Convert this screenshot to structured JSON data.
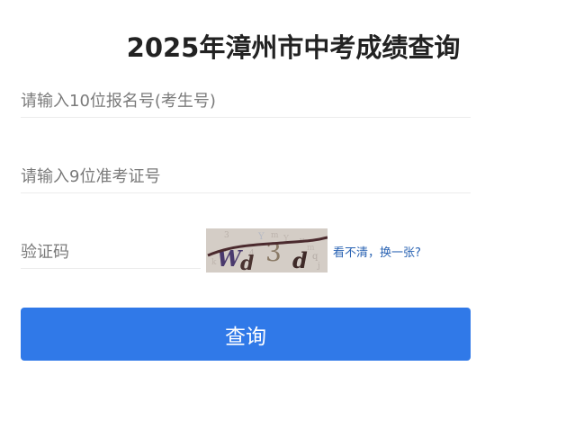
{
  "page": {
    "title": "2025年漳州市中考成绩查询"
  },
  "form": {
    "registration_placeholder": "请输入10位报名号(考生号)",
    "ticket_placeholder": "请输入9位准考证号",
    "captcha_placeholder": "验证码",
    "captcha_text": "Wd3d",
    "captcha_refresh_label": "看不清，换一张?",
    "submit_label": "查询"
  },
  "colors": {
    "primary_button": "#3079e8",
    "link": "#2a63b3",
    "title": "#222222"
  }
}
